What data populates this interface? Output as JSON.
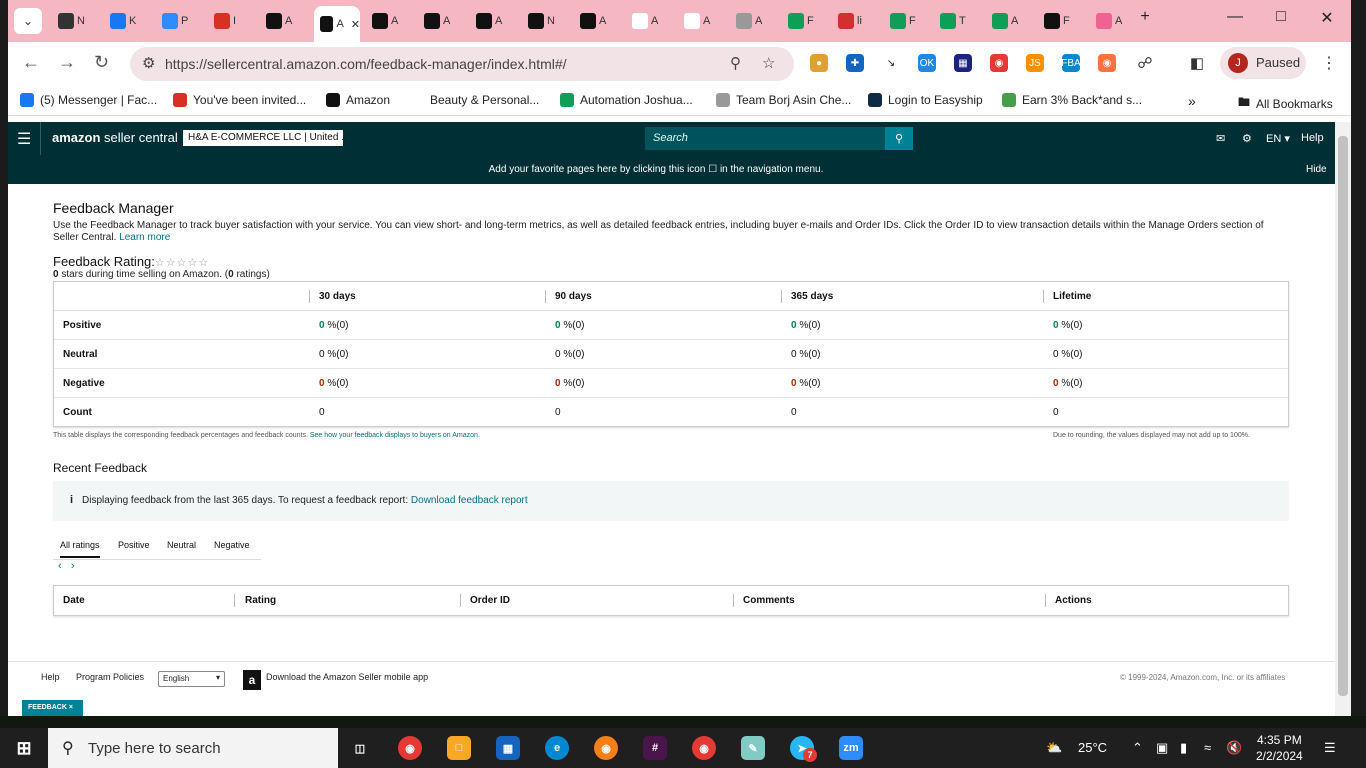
{
  "browser": {
    "tabs": [
      {
        "label": "N",
        "icon": "github-icon",
        "color": "#333333"
      },
      {
        "label": "K",
        "icon": "facebook-icon",
        "color": "#1877f2"
      },
      {
        "label": "P",
        "icon": "zoom-icon",
        "color": "#2d8cff"
      },
      {
        "label": "I",
        "icon": "gmail-icon",
        "color": "#d93025"
      },
      {
        "label": "A",
        "icon": "amazon-icon",
        "color": "#111111"
      },
      {
        "label": "A",
        "icon": "amazon-icon",
        "color": "#111111"
      },
      {
        "label": "A",
        "icon": "amazon-icon",
        "color": "#111111"
      },
      {
        "label": "A",
        "icon": "amazon-icon",
        "color": "#111111"
      },
      {
        "label": "A",
        "icon": "amazon-icon",
        "color": "#111111"
      },
      {
        "label": "N",
        "icon": "amazon-icon",
        "color": "#111111"
      },
      {
        "label": "A",
        "icon": "amazon-icon",
        "color": "#111111"
      },
      {
        "label": "A",
        "icon": "amazon-icon",
        "color": "#ffffff"
      },
      {
        "label": "A",
        "icon": "amazon-icon",
        "color": "#ffffff"
      },
      {
        "label": "A",
        "icon": "amazon-circle-icon",
        "color": "#999999"
      },
      {
        "label": "F",
        "icon": "sheets-icon",
        "color": "#0f9d58"
      },
      {
        "label": "li",
        "icon": "v-icon",
        "color": "#d32f2f"
      },
      {
        "label": "F",
        "icon": "sheets-icon",
        "color": "#0f9d58"
      },
      {
        "label": "T",
        "icon": "sheets-icon",
        "color": "#0f9d58"
      },
      {
        "label": "A",
        "icon": "sheets-icon",
        "color": "#0f9d58"
      },
      {
        "label": "F",
        "icon": "amazon-icon",
        "color": "#111111"
      },
      {
        "label": "A",
        "icon": "pencil-icon",
        "color": "#f06292"
      }
    ],
    "url": "https://sellercentral.amazon.com/feedback-manager/index.html#/",
    "profile_initial": "J",
    "profile_status": "Paused",
    "bookmarks": [
      {
        "label": "(5) Messenger | Fac...",
        "icon": "facebook-icon",
        "color": "#1877f2"
      },
      {
        "label": "You've been invited...",
        "icon": "gmail-icon",
        "color": "#d93025"
      },
      {
        "label": "Amazon",
        "icon": "amazon-icon",
        "color": "#111111"
      },
      {
        "label": "Beauty & Personal...",
        "icon": "amazon-icon",
        "color": "#ffffff"
      },
      {
        "label": "Automation Joshua...",
        "icon": "sheets-icon",
        "color": "#0f9d58"
      },
      {
        "label": "Team Borj Asin Che...",
        "icon": "amz-icon",
        "color": "#999999"
      },
      {
        "label": "Login to Easyship",
        "icon": "easyship-icon",
        "color": "#0f2b46"
      },
      {
        "label": "Earn 3% Back*and s...",
        "icon": "v-icon",
        "color": "#43a047"
      }
    ],
    "all_bookmarks": "All Bookmarks"
  },
  "header": {
    "logo_brand": "amazon",
    "logo_suffix": "seller central",
    "account": "H&A E-COMMERCE LLC | United ...",
    "search_placeholder": "Search",
    "lang": "EN",
    "help": "Help",
    "favorites_msg": "Add your favorite pages here by clicking this icon ☐ in the navigation menu.",
    "hide": "Hide"
  },
  "page": {
    "title": "Feedback Manager",
    "intro": "Use the Feedback Manager to track buyer satisfaction with your service. You can view short- and long-term metrics, as well as detailed feedback entries, including buyer e-mails and Order IDs. Click the Order ID to view transaction details within the Manage Orders section of Seller Central.",
    "learn_more": "Learn more",
    "rating_label": "Feedback Rating:",
    "stars": "☆☆☆☆☆",
    "rating_count": "0",
    "rating_text": "stars during time selling on Amazon. (",
    "ratings_num": "0",
    "ratings_suffix": "ratings)",
    "table": {
      "columns": [
        "30 days",
        "90 days",
        "365 days",
        "Lifetime"
      ],
      "rows": [
        {
          "label": "Positive",
          "value": "0",
          "suffix": "%(0)",
          "style": "green"
        },
        {
          "label": "Neutral",
          "value": "0",
          "suffix": "%(0)",
          "style": "plain"
        },
        {
          "label": "Negative",
          "value": "0",
          "suffix": "%(0)",
          "style": "red"
        },
        {
          "label": "Count",
          "value": "0",
          "suffix": "",
          "style": "plain"
        }
      ]
    },
    "note_left": "This table displays the corresponding feedback percentages and feedback counts.",
    "note_link": "See how your feedback displays to buyers on Amazon.",
    "note_right": "Due to rounding, the values displayed may not add up to 100%.",
    "recent_title": "Recent Feedback",
    "info_text": "Displaying feedback from the last 365 days. To request a feedback report:",
    "info_link": "Download feedback report",
    "rating_tabs": [
      "All ratings",
      "Positive",
      "Neutral",
      "Negative"
    ],
    "feedback_columns": [
      "Date",
      "Rating",
      "Order ID",
      "Comments",
      "Actions"
    ]
  },
  "footer": {
    "help": "Help",
    "policies": "Program Policies",
    "language": "English",
    "mobile_app": "Download the Amazon Seller mobile app",
    "copyright": "© 1999-2024, Amazon.com, Inc. or its affiliates",
    "feedback_btn": "FEEDBACK ×"
  },
  "taskbar": {
    "search_placeholder": "Type here to search",
    "weather": "25°C",
    "time": "4:35 PM",
    "date": "2/2/2024",
    "badge": "7"
  }
}
